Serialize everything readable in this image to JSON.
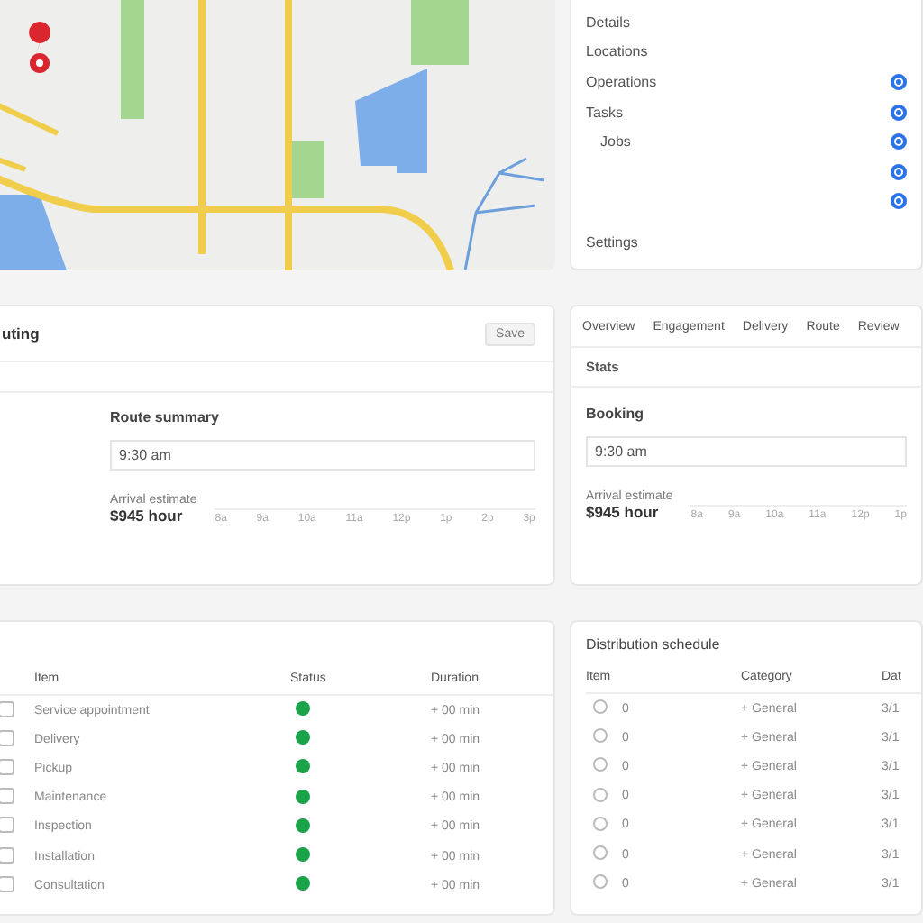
{
  "side_menu": {
    "items": [
      {
        "kind": "text",
        "label": "Details"
      },
      {
        "kind": "text",
        "label": "Locations"
      },
      {
        "kind": "option",
        "label": "Operations",
        "selected": true
      },
      {
        "kind": "option",
        "label": "Tasks",
        "selected": true
      },
      {
        "kind": "option",
        "label": "Jobs",
        "selected": true
      },
      {
        "kind": "option",
        "selected": true
      },
      {
        "kind": "option",
        "selected": true
      },
      {
        "kind": "text",
        "label": "Settings"
      }
    ]
  },
  "routing_panel": {
    "title": "uting",
    "button": "Save",
    "section": "Route summary",
    "field": {
      "value": "9:30 am"
    },
    "estimate_label": "Arrival estimate",
    "estimate": "$945 hour",
    "ticks": [
      "8a",
      "9a",
      "10a",
      "11a",
      "12p",
      "1p",
      "2p",
      "3p"
    ]
  },
  "overview_panel": {
    "tabs": [
      {
        "label": "Overview",
        "selected": false
      },
      {
        "label": "Engagement",
        "selected": false
      },
      {
        "label": "Delivery",
        "selected": false
      },
      {
        "label": "Route",
        "selected": false
      },
      {
        "label": "Review",
        "selected": false
      }
    ],
    "subtitle": "Stats",
    "section": "Booking",
    "field": {
      "value": "9:30 am"
    },
    "estimate_label": "Arrival estimate",
    "estimate": "$945 hour",
    "ticks": [
      "8a",
      "9a",
      "10a",
      "11a",
      "12p",
      "1p"
    ]
  },
  "items_table": {
    "columns": [
      "Item",
      "Status",
      "Duration"
    ],
    "rows": [
      {
        "checked": false,
        "item": "Service appointment",
        "color": "#1aa34a",
        "duration": "+ 00 min"
      },
      {
        "checked": false,
        "item": "Delivery",
        "color": "#1aa34a",
        "duration": "+ 00 min"
      },
      {
        "checked": false,
        "item": "Pickup",
        "color": "#1aa34a",
        "duration": "+ 00 min"
      },
      {
        "checked": false,
        "item": "Maintenance",
        "color": "#1aa34a",
        "duration": "+ 00 min"
      },
      {
        "checked": false,
        "item": "Inspection",
        "color": "#1aa34a",
        "duration": "+ 00 min"
      },
      {
        "checked": false,
        "item": "Installation",
        "color": "#1aa34a",
        "duration": "+ 00 min"
      },
      {
        "checked": false,
        "item": "Consultation",
        "color": "#1aa34a",
        "duration": "+ 00 min"
      }
    ]
  },
  "schedule_table": {
    "title": "Distribution schedule",
    "columns": [
      "Item",
      "Category",
      "Dat"
    ],
    "rows": [
      {
        "number": "0",
        "category": "+ General",
        "date": "3/1"
      },
      {
        "number": "0",
        "category": "+ General",
        "date": "3/1"
      },
      {
        "number": "0",
        "category": "+ General",
        "date": "3/1"
      },
      {
        "number": "0",
        "category": "+ General",
        "date": "3/1"
      },
      {
        "number": "0",
        "category": "+ General",
        "date": "3/1"
      },
      {
        "number": "0",
        "category": "+ General",
        "date": "3/1"
      },
      {
        "number": "0",
        "category": "+ General",
        "date": "3/1"
      }
    ]
  }
}
